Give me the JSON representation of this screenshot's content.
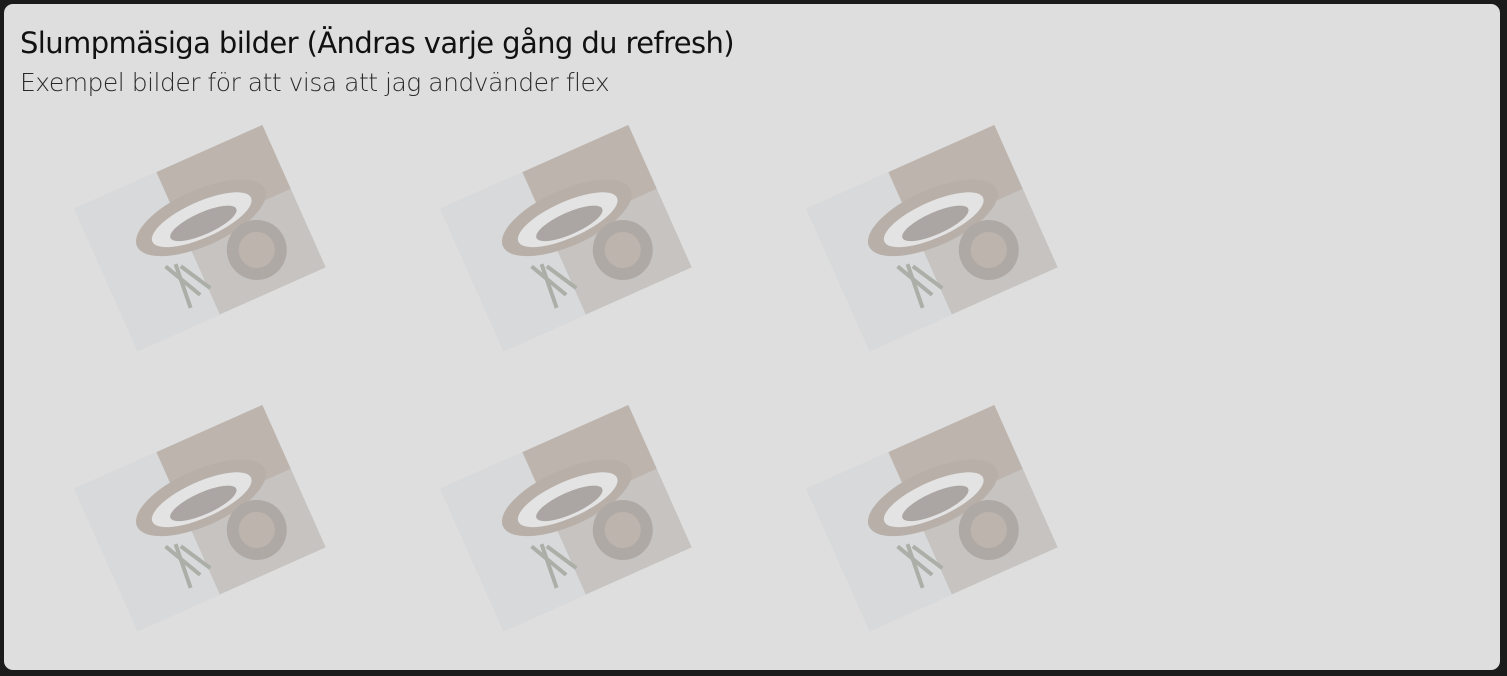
{
  "header": {
    "title": "Slumpmäsiga bilder (Ändras varje gång du refresh)",
    "subtitle": "Exempel bilder för att visa att jag andvänder flex"
  },
  "gallery": {
    "images": [
      {
        "icon": "coffee-cup-photo"
      },
      {
        "icon": "coffee-cup-photo"
      },
      {
        "icon": "coffee-cup-photo"
      },
      {
        "icon": "coffee-cup-photo"
      },
      {
        "icon": "coffee-cup-photo"
      },
      {
        "icon": "coffee-cup-photo"
      }
    ]
  },
  "colors": {
    "page_background": "#1b1b1b",
    "panel_background": "#dedede",
    "title_text": "#111111"
  }
}
